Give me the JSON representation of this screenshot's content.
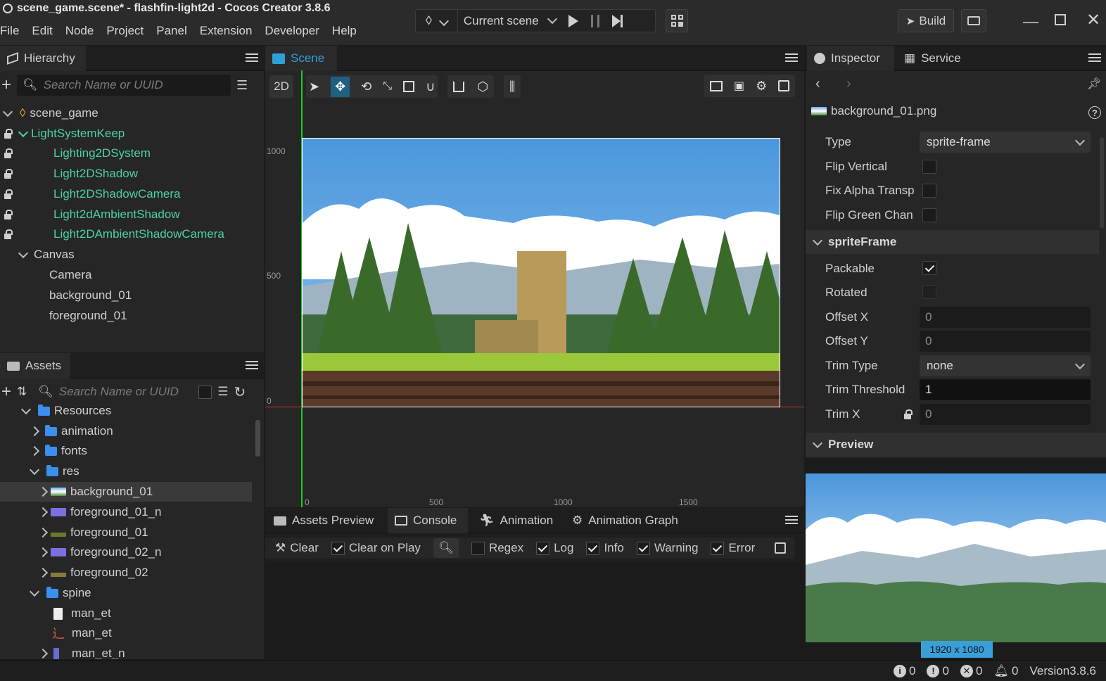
{
  "window": {
    "title": "scene_game.scene* - flashfin-light2d - Cocos Creator 3.8.6"
  },
  "menu": [
    "File",
    "Edit",
    "Node",
    "Project",
    "Panel",
    "Extension",
    "Developer",
    "Help"
  ],
  "toolbar": {
    "scene_select": "Current scene",
    "build_label": "Build"
  },
  "hierarchy": {
    "tab": "Hierarchy",
    "search_placeholder": "Search Name or UUID",
    "items": [
      {
        "label": "scene_game"
      },
      {
        "label": "LightSystemKeep"
      },
      {
        "label": "Lighting2DSystem"
      },
      {
        "label": "Light2DShadow"
      },
      {
        "label": "Light2DShadowCamera"
      },
      {
        "label": "Light2dAmbientShadow"
      },
      {
        "label": "Light2DAmbientShadowCamera"
      },
      {
        "label": "Canvas"
      },
      {
        "label": "Camera"
      },
      {
        "label": "background_01"
      },
      {
        "label": "foreground_01"
      }
    ]
  },
  "assets": {
    "tab": "Assets",
    "search_placeholder": "Search Name or UUID",
    "items": [
      {
        "label": "Resources"
      },
      {
        "label": "animation"
      },
      {
        "label": "fonts"
      },
      {
        "label": "res"
      },
      {
        "label": "background_01"
      },
      {
        "label": "foreground_01_n"
      },
      {
        "label": "foreground_01"
      },
      {
        "label": "foreground_02_n"
      },
      {
        "label": "foreground_02"
      },
      {
        "label": "spine"
      },
      {
        "label": "man_et"
      },
      {
        "label": "man_et"
      },
      {
        "label": "man_et_n"
      }
    ]
  },
  "scene": {
    "tab": "Scene",
    "mode": "2D",
    "ruler_y": [
      "1000",
      "500",
      "0"
    ],
    "ruler_x": [
      "0",
      "500",
      "1000",
      "1500"
    ]
  },
  "bottom": {
    "tabs": [
      "Assets Preview",
      "Console",
      "Animation",
      "Animation Graph"
    ],
    "console": {
      "clear": "Clear",
      "clear_on_play": "Clear on Play",
      "regex": "Regex",
      "log": "Log",
      "info": "Info",
      "warning": "Warning",
      "error": "Error"
    }
  },
  "inspector": {
    "tabs": [
      "Inspector",
      "Service"
    ],
    "asset_name": "background_01.png",
    "type_label": "Type",
    "type_value": "sprite-frame",
    "flip_vertical": "Flip Vertical",
    "fix_alpha": "Fix Alpha Transp",
    "flip_green": "Flip Green Chan",
    "sprite_frame": "spriteFrame",
    "packable": "Packable",
    "rotated": "Rotated",
    "offset_x": "Offset X",
    "offset_x_val": "0",
    "offset_y": "Offset Y",
    "offset_y_val": "0",
    "trim_type": "Trim Type",
    "trim_type_val": "none",
    "trim_threshold": "Trim Threshold",
    "trim_threshold_val": "1",
    "trim_x": "Trim X",
    "trim_x_val": "0",
    "preview": "Preview",
    "dimensions": "1920 x 1080"
  },
  "status": {
    "info": "0",
    "warn": "0",
    "error": "0",
    "notify": "0",
    "version": "Version3.8.6"
  },
  "colors": {
    "accent": "#2f9fd8",
    "node_green": "#4fd1a1",
    "x_axis": "#e02c2c",
    "y_axis": "#1ec81e"
  }
}
